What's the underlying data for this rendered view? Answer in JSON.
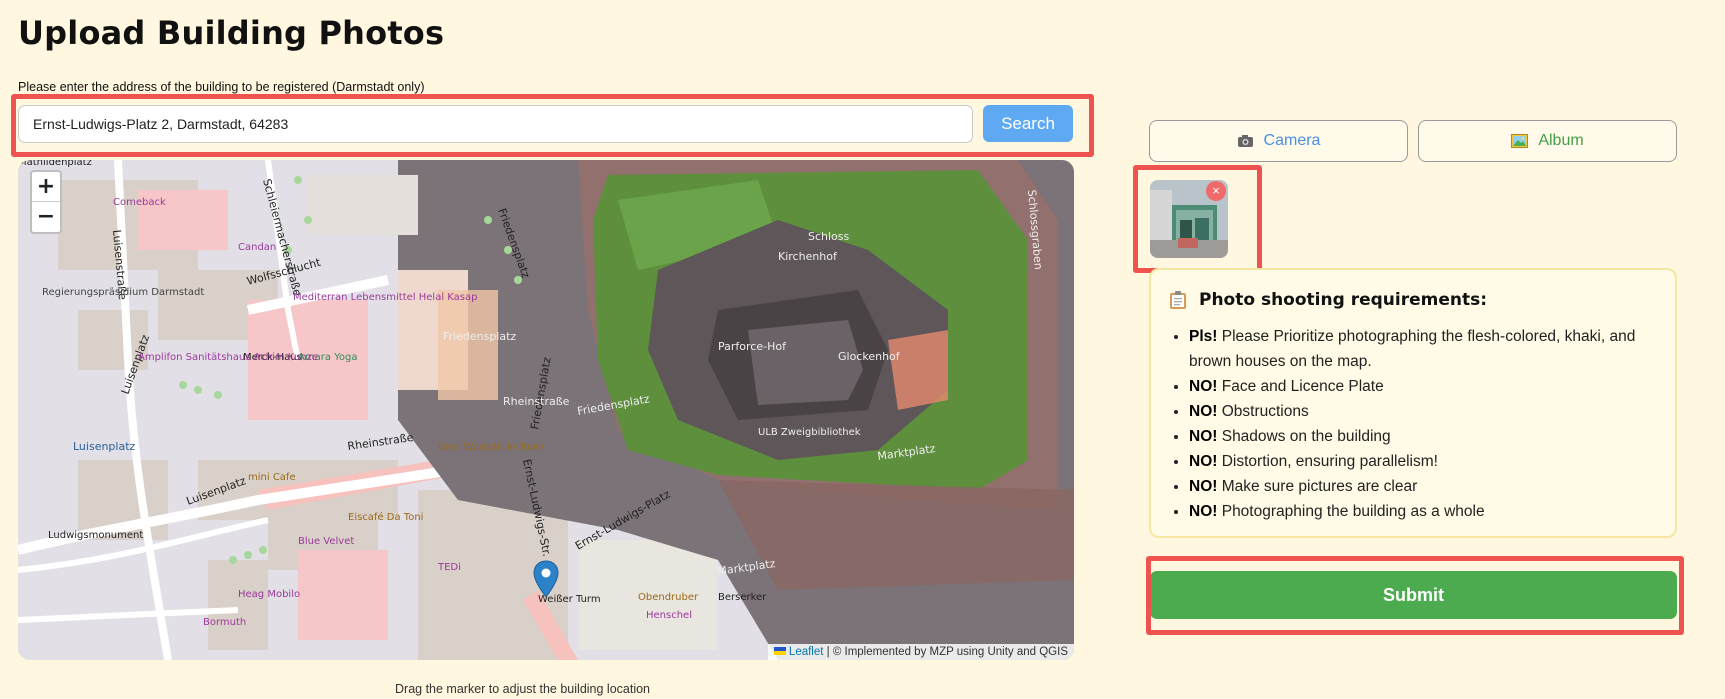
{
  "page": {
    "title": "Upload Building Photos",
    "address_label": "Please enter the address of the building to be registered (Darmstadt only)",
    "map_hint": "Drag the marker to adjust the building location"
  },
  "search": {
    "value": "Ernst-Ludwigs-Platz 2, Darmstadt, 64283",
    "button_label": "Search"
  },
  "map": {
    "zoom_in": "+",
    "zoom_out": "−",
    "attribution_link": "Leaflet",
    "attribution_text": " | © Implemented by MZP using Unity and QGIS",
    "labels": {
      "schloss": "Schloss",
      "kirchenhof": "Kirchenhof",
      "glockenhof": "Glockenhof",
      "parforcehof": "Parforce-Hof",
      "friedensplatz": "Friedensplatz",
      "marktplatz": "Marktplatz",
      "rheinstrasse": "Rheinstraße",
      "luisenplatz": "Luisenplatz",
      "luisenstrasse": "Luisenstraße",
      "wolfsschlucht": "Wolfsschlucht",
      "ernst_ludwigs_platz": "Ernst-Ludwigs-Platz",
      "ernst_ludwigs_strasse": "Ernst-Ludwigs-Str.",
      "weisser_turm": "Weißer Turm",
      "ludwigsmonument": "Ludwigsmonument",
      "regierungspraesidium": "Regierungspräsidium Darmstadt",
      "mediterran": "Mediterran Lebensmittel Helal Kasap",
      "eiscafe": "Eiscafé Da Toni",
      "blue_velvet": "Blue Velvet",
      "mini_cafe": "mini Cafe",
      "obendruber": "Obendruber",
      "henschel": "Henschel",
      "berserker": "Berserker",
      "heag_mobilo": "Heag Mobilo",
      "bormuth": "Bormuth",
      "schleiermacherstrasse": "Schleiermacherstraße",
      "comeback": "Comeback",
      "candan": "Candan",
      "merck_haus": "Merck-Haus",
      "amara_yoga": "Amara Yoga",
      "amplifon": "Amplifon Sanitätshaus Achim Kunze",
      "schlossgraben": "Schlossgraben",
      "ulb": "ULB Zweigbibliothek",
      "tedi": "TEDi",
      "best_wurscht": "Best Worscht in Town",
      "ernst_ludwigs_platz_top": "Mathildenplatz"
    }
  },
  "media": {
    "camera_label": "Camera",
    "album_label": "Album",
    "remove_label": "×"
  },
  "requirements": {
    "title": "Photo shooting requirements:",
    "items": [
      {
        "prefix": "Pls!",
        "text": " Please Prioritize photographing the flesh-colored, khaki, and brown houses on the map."
      },
      {
        "prefix": "NO!",
        "text": " Face and Licence Plate"
      },
      {
        "prefix": "NO!",
        "text": " Obstructions"
      },
      {
        "prefix": "NO!",
        "text": " Shadows on the building"
      },
      {
        "prefix": "NO!",
        "text": " Distortion, ensuring parallelism!"
      },
      {
        "prefix": "NO!",
        "text": " Make sure pictures are clear"
      },
      {
        "prefix": "NO!",
        "text": " Photographing the building as a whole"
      }
    ]
  },
  "submit": {
    "label": "Submit"
  },
  "colors": {
    "background": "#fff7df",
    "search_button": "#5fa9f2",
    "submit_button": "#4caa4f",
    "highlight": "#ef5350",
    "camera_text": "#4a90e2",
    "album_text": "#43a047"
  }
}
